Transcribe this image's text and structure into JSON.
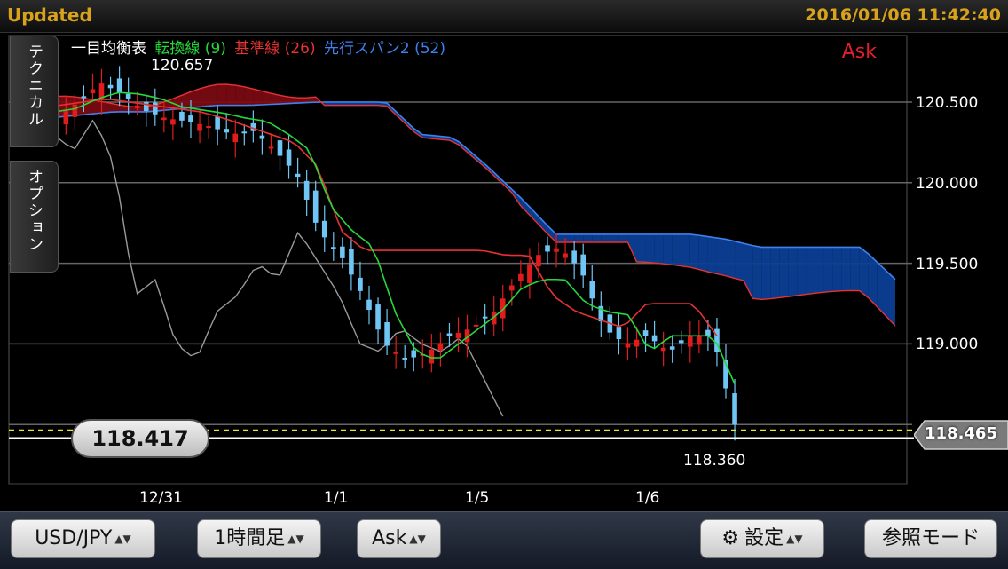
{
  "topbar": {
    "status": "Updated",
    "datetime": "2016/01/06 11:42:40"
  },
  "legend": {
    "title": "一目均衡表",
    "tenkan": "転換線 (9)",
    "kijun": "基準線 (26)",
    "span2": "先行スパン2 (52)"
  },
  "price_side": "Ask",
  "side_tabs": {
    "technical": "テクニカル",
    "option": "オプション"
  },
  "high_label": "120.657",
  "low_label": "118.360",
  "current_price": "118.417",
  "right_tag": "118.465",
  "colors": {
    "tenkan": "#26d93a",
    "kijun": "#e63232",
    "span2": "#3d82ee",
    "chikou": "#9a9a9a",
    "up_candle": "#e01c1c",
    "down_candle": "#6fc6f4",
    "cloud_bear": "#0b3e94",
    "cloud_bull": "#7a0b12",
    "accent": "#d9a21b"
  },
  "chart_data": {
    "type": "line",
    "title": "一目均衡表",
    "y_ticks": [
      "120.500",
      "120.000",
      "119.500",
      "119.000"
    ],
    "x_ticks": [
      "12/31",
      "1/1",
      "1/5",
      "1/6"
    ],
    "ylim": [
      118.32,
      120.7
    ],
    "grid": true,
    "series": [
      {
        "name": "転換線 (9)",
        "values": [
          120.48,
          120.46,
          120.44,
          120.46,
          120.52,
          120.56,
          120.55,
          120.52,
          120.47,
          120.45,
          120.43,
          120.4,
          120.38,
          120.3,
          120.2,
          119.85,
          119.7,
          119.6,
          119.2,
          118.95,
          118.9,
          119.0,
          119.1,
          119.2,
          119.35,
          119.4,
          119.4,
          119.25,
          119.2,
          119.18,
          118.95,
          119.05,
          119.05,
          119.05,
          118.75
        ]
      },
      {
        "name": "基準線 (26)",
        "values": [
          120.45,
          120.46,
          120.48,
          120.5,
          120.52,
          120.5,
          120.48,
          120.46,
          120.44,
          120.4,
          120.35,
          120.3,
          120.25,
          120.1,
          119.7,
          119.58,
          119.58,
          119.58,
          119.58,
          119.58,
          119.58,
          119.55,
          119.55,
          119.3,
          119.2,
          119.15,
          119.1,
          119.25,
          119.25,
          119.25,
          119.05
        ]
      },
      {
        "name": "先行スパン2 (52)",
        "values": [
          120.4,
          120.4,
          120.42,
          120.44,
          120.44,
          120.46,
          120.48,
          120.48,
          120.49,
          120.5,
          120.5,
          120.5,
          120.3,
          120.28,
          120.1,
          119.9,
          119.68,
          119.68,
          119.68,
          119.68,
          119.68,
          119.65,
          119.6,
          119.6,
          119.6,
          119.6,
          119.4
        ]
      }
    ]
  },
  "toolbar": {
    "symbol": "USD/JPY",
    "timeframe": "1時間足",
    "side": "Ask",
    "settings": "設定",
    "mode": "参照モード"
  }
}
